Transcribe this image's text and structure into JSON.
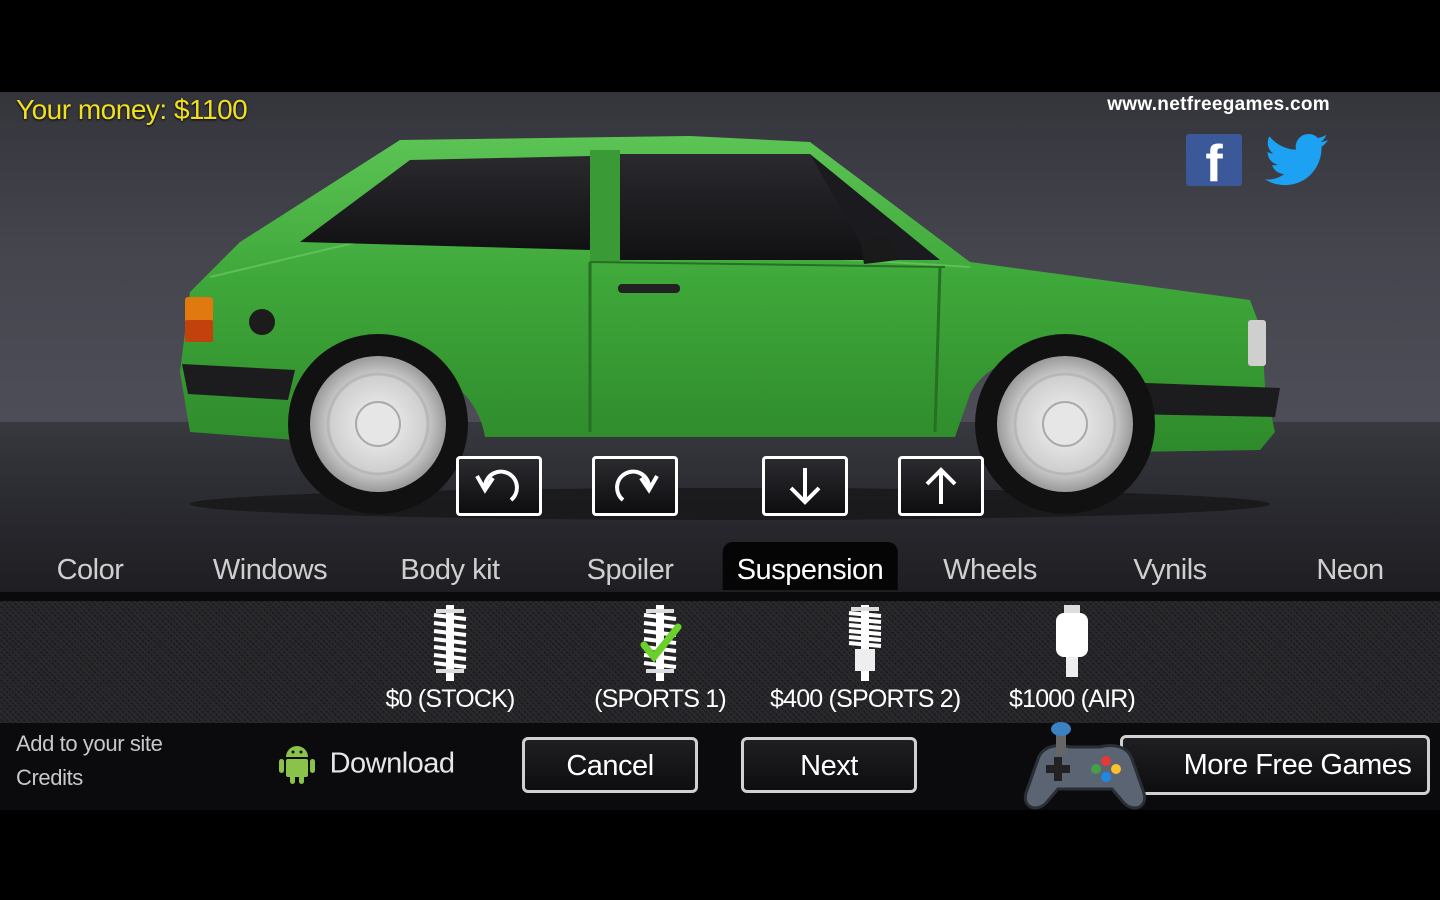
{
  "hud": {
    "money_label": "Your money: $1100",
    "site_url": "www.netfreegames.com",
    "facebook_glyph": "f"
  },
  "car": {
    "body_color": "#3fa83a"
  },
  "controls": [
    {
      "name": "rotate-left-button",
      "icon": "rotate-ccw-icon"
    },
    {
      "name": "rotate-right-button",
      "icon": "rotate-cw-icon"
    },
    {
      "name": "lower-button",
      "icon": "arrow-down-icon"
    },
    {
      "name": "raise-button",
      "icon": "arrow-up-icon"
    }
  ],
  "tabs": [
    {
      "label": "Color"
    },
    {
      "label": "Windows"
    },
    {
      "label": "Body kit"
    },
    {
      "label": "Spoiler"
    },
    {
      "label": "Suspension",
      "active": true
    },
    {
      "label": "Wheels"
    },
    {
      "label": "Vynils"
    },
    {
      "label": "Neon"
    }
  ],
  "options": [
    {
      "label": "$0 (STOCK)",
      "icon": "coil-spring-icon",
      "selected": false
    },
    {
      "label": "(SPORTS 1)",
      "icon": "coil-spring-icon",
      "selected": true
    },
    {
      "label": "$400 (SPORTS 2)",
      "icon": "coil-spring-icon",
      "selected": false
    },
    {
      "label": "$1000 (AIR)",
      "icon": "air-suspension-icon",
      "selected": false
    }
  ],
  "footer": {
    "add_to_site": "Add to your site",
    "credits": "Credits",
    "download": "Download",
    "cancel": "Cancel",
    "next": "Next",
    "more_games": "More Free Games"
  }
}
